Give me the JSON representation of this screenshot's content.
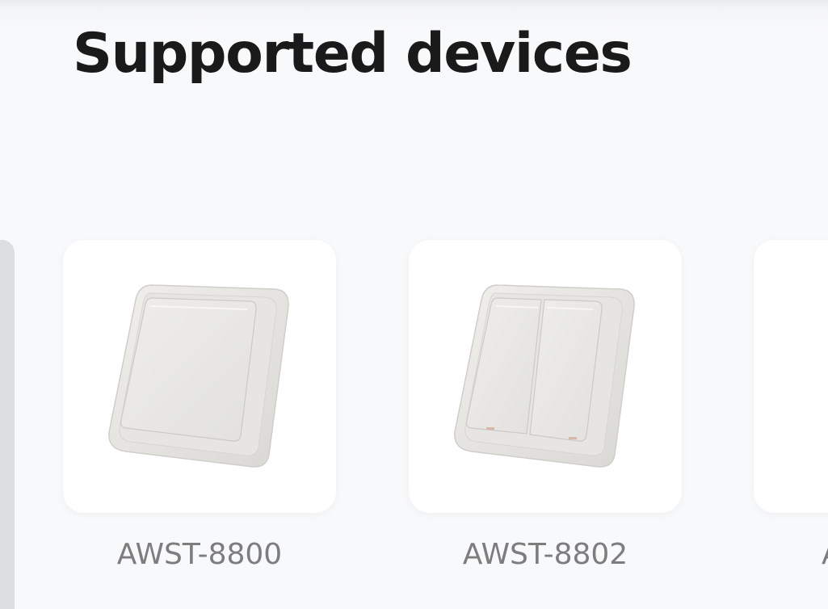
{
  "page": {
    "title": "Supported devices"
  },
  "devices": [
    {
      "model": "AWST-8800",
      "image_icon": "single-rocker-wall-switch-icon"
    },
    {
      "model": "AWST-8802",
      "image_icon": "double-rocker-wall-switch-icon"
    },
    {
      "model": "A",
      "image_icon": "wall-switch-icon"
    }
  ],
  "colors": {
    "background": "#f8f9fb",
    "title": "#1a1a1a",
    "label": "#7d7d7d",
    "card": "#ffffff"
  }
}
